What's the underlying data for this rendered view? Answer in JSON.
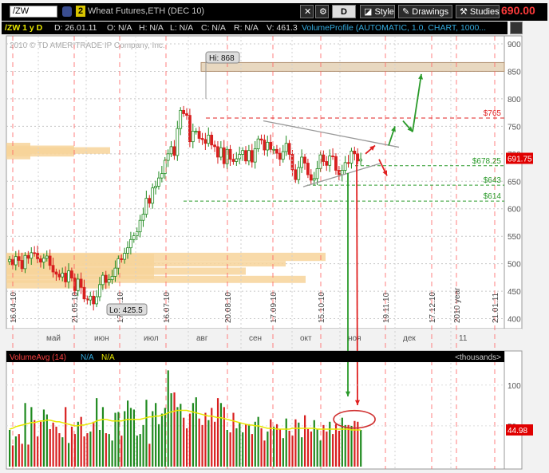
{
  "toolbar": {
    "symbol": "/ZW",
    "link_number": "2",
    "description": "Wheat Futures,ETH (DEC 10)",
    "aggregation": "D",
    "style_label": "Style",
    "drawings_label": "Drawings",
    "studies_label": "Studies",
    "last_price": "690.00"
  },
  "infobar": {
    "symbol_period": "/ZW 1 y D",
    "date": "D: 26.01.11",
    "open": "O: N/A",
    "high": "H: N/A",
    "low": "L: N/A",
    "close": "C: N/A",
    "range": "R: N/A",
    "value": "V: 461.3",
    "study": "VolumeProfile (AUTOMATIC, 1.0, CHART, 1000..."
  },
  "icons": {
    "settings": "chart-settings-icon",
    "link": "link-icon",
    "style": "style-icon",
    "drawings": "pencil-icon",
    "studies": "studies-icon"
  },
  "colors": {
    "up_candle": "#1f8a1f",
    "down_candle": "#d81f1f",
    "volume_profile": "#f7d49a",
    "resistance": "#e02020",
    "support": "#2a9a2a",
    "ma_line": "#e8e800",
    "price_badge": "#e00000"
  },
  "chart_data": [
    {
      "type": "candlestick",
      "watermark": "2010 © TD AMERITRADE IP Company, Inc.",
      "ylim": [
        395,
        900
      ],
      "y_ticks": [
        "900",
        "850",
        "800",
        "750",
        "700",
        "650",
        "600",
        "550",
        "500",
        "450",
        "400"
      ],
      "month_labels": [
        "май",
        "июн",
        "июл",
        "авг",
        "сен",
        "окт",
        "ноя",
        "дек",
        "11"
      ],
      "date_labels": [
        "16.04.10",
        "21.05.10",
        "17.06.10",
        "16.07.10",
        "20.08.10",
        "17.09.10",
        "15.10.10",
        "19.11.10",
        "17.12.10",
        "2010 year",
        "21.01.11"
      ],
      "series": [
        {
          "name": "",
          "values": [
            508,
            498,
            513,
            506,
            491,
            515,
            510,
            520,
            519,
            509,
            503,
            510,
            514,
            497,
            485,
            481,
            476,
            483,
            467,
            487,
            474,
            451,
            472,
            457,
            436,
            434,
            441,
            427,
            440,
            462,
            479,
            466,
            471,
            477,
            492,
            509,
            508,
            519,
            529,
            544,
            551,
            558,
            579,
            590,
            619,
            610,
            638,
            641,
            656,
            664,
            688,
            700,
            713,
            697,
            746,
            779,
            773,
            770,
            722,
            741,
            741,
            728,
            726,
            719,
            734,
            716,
            713,
            694,
            711,
            682,
            708,
            690,
            686,
            691,
            699,
            706,
            687,
            706,
            685,
            709,
            727,
            725,
            707,
            721,
            708,
            708,
            701,
            690,
            704,
            719,
            699,
            671,
            653,
            675,
            694,
            683,
            662,
            652,
            655,
            673,
            698,
            686,
            679,
            696,
            695,
            670,
            662,
            670,
            684,
            683,
            705,
            700,
            687,
            690
          ]
        }
      ],
      "annotations": [
        {
          "label": "Hi: 868",
          "value": 868
        },
        {
          "label": "Lo: 425.5",
          "value": 425.5
        },
        {
          "label": "$765",
          "value": 765
        },
        {
          "label": "$678.25",
          "value": 678.25
        },
        {
          "label": "$643",
          "value": 643
        },
        {
          "label": "$614",
          "value": 614
        },
        {
          "label": "691.75",
          "value": 691.75
        }
      ],
      "grid": true
    },
    {
      "type": "bar",
      "study_label": "VolumeAvg (14)",
      "legend": [
        "N/A",
        "N/A"
      ],
      "units_label": "<thousands>",
      "y_ticks": [
        "100",
        "50"
      ],
      "ylim": [
        0,
        135
      ],
      "last_value": "44.98",
      "values": [
        45,
        26,
        37,
        40,
        28,
        78,
        27,
        73,
        57,
        37,
        55,
        70,
        64,
        46,
        54,
        49,
        41,
        36,
        73,
        29,
        49,
        40,
        55,
        61,
        37,
        41,
        43,
        55,
        84,
        45,
        73,
        41,
        40,
        32,
        66,
        67,
        38,
        68,
        81,
        72,
        70,
        38,
        40,
        51,
        82,
        28,
        68,
        78,
        52,
        65,
        72,
        118,
        90,
        91,
        73,
        77,
        60,
        47,
        65,
        78,
        85,
        59,
        51,
        66,
        57,
        72,
        55,
        84,
        78,
        73,
        45,
        42,
        66,
        47,
        54,
        42,
        52,
        52,
        40,
        55,
        61,
        47,
        32,
        43,
        58,
        49,
        52,
        46,
        35,
        59,
        44,
        38,
        58,
        54,
        36,
        63,
        46,
        43,
        57,
        46,
        32,
        51,
        43,
        55,
        40,
        52,
        44,
        60,
        51,
        51,
        50,
        56,
        55,
        45
      ],
      "ma_values": [
        46,
        47,
        49,
        50,
        51,
        52,
        53,
        54,
        54,
        55,
        56,
        56,
        57,
        57,
        56,
        55,
        55,
        54,
        53,
        52,
        51,
        50,
        50,
        51,
        51,
        52,
        53,
        54,
        56,
        57,
        58,
        58,
        57,
        56,
        56,
        56,
        56,
        57,
        58,
        58,
        58,
        58,
        58,
        59,
        60,
        61,
        61,
        62,
        62,
        63,
        64,
        66,
        67,
        68,
        69,
        69,
        69,
        69,
        68,
        67,
        66,
        65,
        64,
        63,
        62,
        62,
        61,
        60,
        60,
        59,
        58,
        57,
        56,
        55,
        54,
        53,
        52,
        51,
        51,
        50,
        50,
        49,
        48,
        47,
        47,
        47,
        46,
        46,
        46,
        46,
        46,
        47,
        47,
        47,
        47,
        47,
        47,
        47,
        47,
        46,
        46,
        46,
        46,
        46,
        46,
        46,
        46,
        46,
        46,
        46,
        45,
        45,
        45,
        45
      ]
    }
  ]
}
